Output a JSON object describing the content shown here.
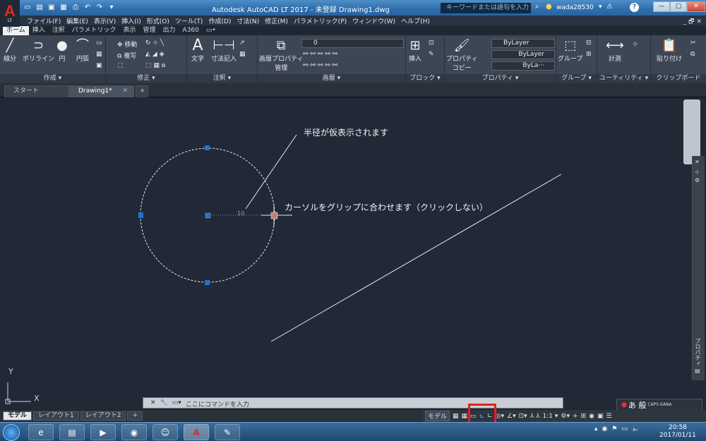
{
  "titlebar": {
    "logo_letter": "A",
    "logo_sub": "LT",
    "title": "Autodesk AutoCAD LT 2017 - 未登録    Drawing1.dwg",
    "search_placeholder": "キーワードまたは語句を入力",
    "user": "wada28530",
    "help": "?"
  },
  "menus": [
    "ファイル(F)",
    "編集(E)",
    "表示(V)",
    "挿入(I)",
    "形式(O)",
    "ツール(T)",
    "作成(D)",
    "寸法(N)",
    "修正(M)",
    "パラメトリック(P)",
    "ウィンドウ(W)",
    "ヘルプ(H)"
  ],
  "mdi": "_ 🗗 ✕",
  "ribbon_tabs": [
    "ホーム",
    "挿入",
    "注釈",
    "パラメトリック",
    "表示",
    "管理",
    "出力",
    "A360",
    "▭•"
  ],
  "ribbon": {
    "draw": {
      "title": "作成 ▾",
      "line": "線分",
      "polyline": "ポリライン",
      "circle": "円",
      "arc": "円弧"
    },
    "modify": {
      "title": "修正 ▾",
      "move": "移動",
      "copy": "複写"
    },
    "annotation": {
      "title": "注釈 ▾",
      "text": "文字",
      "dimension": "寸法記入"
    },
    "layers": {
      "title": "画層 ▾",
      "props": "画層プロパティ",
      "manage": "管理",
      "current_layer": "0"
    },
    "block": {
      "title": "ブロック ▾",
      "insert": "挿入"
    },
    "properties": {
      "title": "プロパティ ▾",
      "match": "プロパティ",
      "match2": "コピー",
      "color": "ByLayer",
      "linetype": "ByLayer",
      "lineweight": "ByLa···"
    },
    "groups": {
      "title": "グループ ▾",
      "group": "グループ"
    },
    "utilities": {
      "title": "ユーティリティ ▾",
      "measure": "計測"
    },
    "clipboard": {
      "title": "クリップボード",
      "paste": "貼り付け"
    }
  },
  "doc_tabs": {
    "start": "スタート",
    "drawing": "Drawing1*",
    "close": "✕",
    "add": "+"
  },
  "canvas": {
    "callout_radius": "半径が仮表示されます",
    "callout_grip": "カーソルをグリップに合わせます（クリックしない）",
    "dim_value": "10",
    "ucs_x": "X",
    "ucs_y": "Y",
    "palette_label": "プロパティ"
  },
  "cmdline": {
    "placeholder": "ここにコマンドを入力",
    "close": "✕",
    "settings": "🔧"
  },
  "ime": {
    "mode": "あ 般",
    "caps": "CAPS KANA"
  },
  "layout_tabs": [
    "モデル",
    "レイアウト1",
    "レイアウト2",
    "+"
  ],
  "status": {
    "model": "モデル",
    "scale": "1:1 ▾"
  },
  "taskbar": {
    "time": "20:58",
    "date": "2017/01/11"
  }
}
